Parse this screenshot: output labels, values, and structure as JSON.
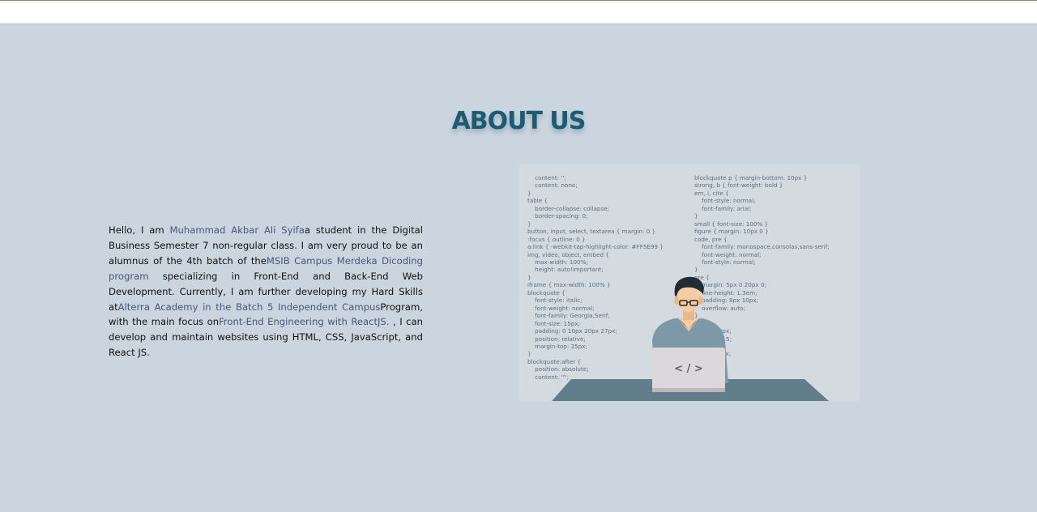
{
  "page_title": "ABOUT US",
  "about": {
    "p1": "Hello, I am ",
    "name": "Muhammad Akbar Ali Syifa",
    "p2": "a student in the Digital Business Semester 7 non-regular class. I am very proud to be an alumnus of the 4th batch of the",
    "program": "MSIB Campus Merdeka Dicoding program",
    "p3": " specializing in Front-End and Back-End Web Development. Currently, I am further developing my Hard Skills at",
    "academy": "Alterra Academy in the Batch 5 Independent Campus",
    "p4": "Program, with the main focus on",
    "focus": "Front-End Engineering with ReactJS.",
    "p5": " , I can develop and maintain websites using HTML, CSS, JavaScript, and React JS."
  },
  "illustration": {
    "code_left": [
      "    content: '';",
      "    content: none;",
      "}",
      "table {",
      "    border-collapse: collapse;",
      "    border-spacing: 0;",
      "}",
      "button, input, select, textarea { margin: 0 }",
      ":focus { outline: 0 }",
      "a:link { -webkit-tap-highlight-color: #FF5E99 }",
      "img, video, object, embed {",
      "    max-width: 100%;",
      "    height: auto!important;",
      "}",
      "iframe { max-width: 100% }",
      "blockquote {",
      "    font-style: italic;",
      "    font-weight: normal;",
      "    font-family: Georgia,Serif;",
      "    font-size: 15px;",
      "    padding: 0 10px 20px 27px;",
      "    position: relative;",
      "    margin-top: 25px;",
      "}",
      "blockquote:after {",
      "    position: absolute;",
      "    content: '\"';"
    ],
    "code_right": [
      "blockquote p { margin-bottom: 10px }",
      "strong, b { font-weight: bold }",
      "em, i, cite {",
      "    font-style: normal;",
      "    font-family: arial;",
      "}",
      "small { font-size: 100% }",
      "figure { margin: 10px 0 }",
      "code, pre {",
      "    font-family: monospace,consolas,sans-serif;",
      "    font-weight: normal;",
      "    font-style: normal;",
      "}",
      "pre {",
      "    margin: 5px 0 20px 0;",
      "    line-height: 1.3em;",
      "    padding: 8px 10px;",
      "    overflow: auto;",
      "}",
      "    {",
      "    ng: 0 8px;",
      "    eight: 1.5;",
      "",
      "    : 1px 6px;",
      "    0 2px;",
      "    black;"
    ],
    "laptop_glyph": "< / >",
    "colors": {
      "desk": "#637e8b",
      "shirt": "#7d98a6",
      "laptop": "#dcd7da",
      "skin": "#f6cda2",
      "hair": "#232b33"
    }
  },
  "colors": {
    "background": "#cbd5e0",
    "title": "#1d5b73",
    "link": "#465877"
  }
}
